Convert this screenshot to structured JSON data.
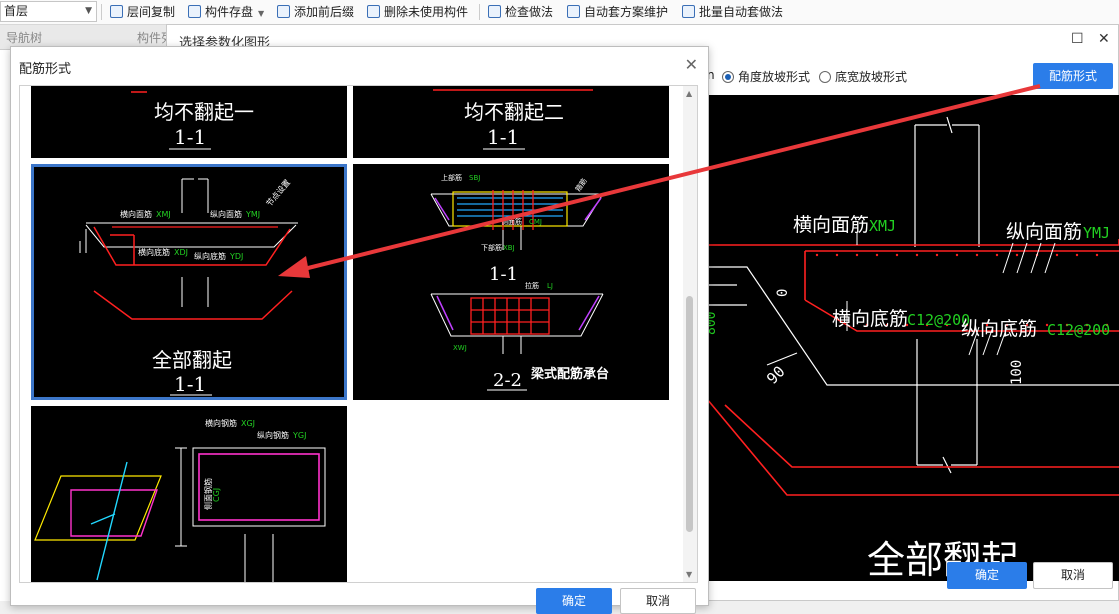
{
  "toolbar": {
    "floor_value": "首层",
    "buttons": [
      "层间复制",
      "构件存盘",
      "添加前后缀",
      "删除未使用构件",
      "检查做法",
      "自动套方案维护",
      "批量自动套做法"
    ]
  },
  "background_tabs": [
    "导航树",
    "构件列"
  ],
  "outer_dialog": {
    "title": "选择参数化图形",
    "radio_partial": "n",
    "radio_angle": "角度放坡形式",
    "radio_width": "底宽放坡形式",
    "rebar_button": "配筋形式",
    "ok": "确定",
    "cancel": "取消",
    "preview": {
      "label_hmj": "横向面筋",
      "code_xmj": "XMJ",
      "label_zmj": "纵向面筋",
      "code_ymj": "YMJ",
      "dim_zero": "0",
      "label_hdj": "横向底筋",
      "spec_hdj": "C12@200",
      "label_zdj": "纵向底筋",
      "spec_zdj": "C12@200",
      "angle": "90",
      "dim_100": "100",
      "dim_left": "800",
      "caption": "全部翻起"
    }
  },
  "inner_dialog": {
    "title": "配筋形式",
    "ok": "确定",
    "cancel": "取消",
    "tiles": [
      {
        "caption": "均不翻起一",
        "section": "1-1"
      },
      {
        "caption": "均不翻起二",
        "section": "1-1"
      },
      {
        "caption": "全部翻起",
        "section": "1-1",
        "labels": {
          "hmj": "横向面筋",
          "xmj": "XMJ",
          "zmj": "纵向面筋",
          "ymj": "YMJ",
          "hdj": "横向底筋",
          "xdj": "XDJ",
          "zdj": "纵向底筋",
          "ydj": "YDJ",
          "jd": "节点设置"
        }
      },
      {
        "caption": "梁式配筋承台",
        "section1": "1-1",
        "section2": "2-2",
        "labels": {
          "top": "上部筋",
          "sbj": "SBJ",
          "side": "侧面筋",
          "cmj": "CMJ",
          "gj": "箍筋",
          "dbj": "下部筋",
          "xbj": "XBJ",
          "ld": "拉筋",
          "lj": "LJ",
          "xwj": "XWJ"
        }
      },
      {
        "labels": {
          "hx": "横向钢筋",
          "xgj": "XGJ",
          "zx": "纵向钢筋",
          "ygj": "YGJ",
          "cgj": "CGJ",
          "side": "侧面钢筋"
        }
      }
    ]
  },
  "colors": {
    "accent": "#2b7de9",
    "selected_tile": "#3c76c9",
    "arrow": "#e8383a",
    "rebar": "#ff2020",
    "cad_green": "#22d022"
  }
}
